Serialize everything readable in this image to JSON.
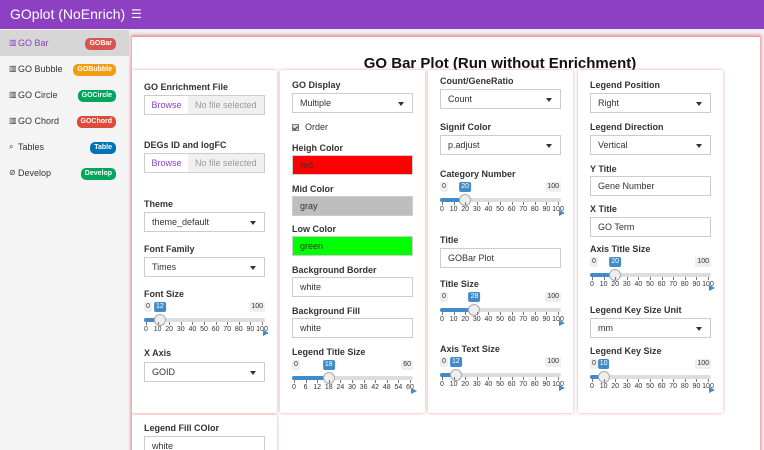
{
  "app": {
    "title": "GOplot (NoEnrich)"
  },
  "header": {
    "toggle_icon": "hamburger-icon"
  },
  "sidebar": {
    "items": [
      {
        "label": "GO Bar",
        "badge": "GOBar",
        "badge_color": "#d9534f",
        "icon": "barcode-icon",
        "active": true
      },
      {
        "label": "GO Bubble",
        "badge": "GOBubble",
        "badge_color": "#f39c12",
        "icon": "chart-icon"
      },
      {
        "label": "GO Circle",
        "badge": "GOCircle",
        "badge_color": "#00a65a",
        "icon": "chart-icon"
      },
      {
        "label": "GO Chord",
        "badge": "GOChord",
        "badge_color": "#dd4b39",
        "icon": "chart-icon"
      },
      {
        "label": "Tables",
        "badge": "Table",
        "badge_color": "#0073b7",
        "icon": "table-icon"
      },
      {
        "label": "Develop",
        "badge": "Develop",
        "badge_color": "#00a65a",
        "icon": "dev-icon"
      }
    ]
  },
  "page": {
    "title": "GO Bar Plot (Run without Enrichment)"
  },
  "col1": {
    "enrich_label": "GO Enrichment File",
    "enrich_browse": "Browse",
    "enrich_file": "No file selected",
    "degs_label": "DEGs ID and logFC",
    "degs_browse": "Browse",
    "degs_file": "No file selected",
    "theme_label": "Theme",
    "theme_value": "theme_default",
    "font_family_label": "Font Family",
    "font_family_value": "Times",
    "font_size_label": "Font Size",
    "font_size": {
      "min": "0",
      "max": "100",
      "value": "12",
      "ticks": [
        "0",
        "10",
        "20",
        "30",
        "40",
        "50",
        "60",
        "70",
        "80",
        "90",
        "100"
      ]
    },
    "xaxis_label": "X Axis",
    "xaxis_value": "GOID",
    "legend_fill_label": "Legend Fill COlor",
    "legend_fill_value": "white"
  },
  "col2": {
    "display_label": "GO Display",
    "display_value": "Multiple",
    "order_label": "Order",
    "heigh_label": "Heigh Color",
    "heigh_value": "red",
    "heigh_color": "#ff0000",
    "mid_label": "Mid Color",
    "mid_value": "gray",
    "mid_color": "#bebebe",
    "low_label": "Low Color",
    "low_value": "green",
    "low_color": "#00ff00",
    "bg_border_label": "Background Border",
    "bg_border_value": "white",
    "bg_fill_label": "Background Fill",
    "bg_fill_value": "white",
    "legend_title_size_label": "Legend Title Size",
    "legend_title_size": {
      "min": "0",
      "max": "60",
      "value": "18",
      "ticks": [
        "0",
        "6",
        "12",
        "18",
        "24",
        "30",
        "36",
        "42",
        "48",
        "54",
        "60"
      ]
    }
  },
  "col3": {
    "count_label": "Count/GeneRatio",
    "count_value": "Count",
    "signif_label": "Signif Color",
    "signif_value": "p.adjust",
    "category_label": "Category Number",
    "category": {
      "min": "0",
      "max": "100",
      "value": "20",
      "ticks": [
        "0",
        "10",
        "20",
        "30",
        "40",
        "50",
        "60",
        "70",
        "80",
        "90",
        "100"
      ]
    },
    "title_label": "Title",
    "title_value": "GOBar Plot",
    "title_size_label": "Title Size",
    "title_size": {
      "min": "0",
      "max": "100",
      "value": "28",
      "ticks": [
        "0",
        "10",
        "20",
        "30",
        "40",
        "50",
        "60",
        "70",
        "80",
        "90",
        "100"
      ]
    },
    "axis_text_size_label": "Axis Text Size",
    "axis_text_size": {
      "min": "0",
      "max": "100",
      "value": "12",
      "ticks": [
        "0",
        "10",
        "20",
        "30",
        "40",
        "50",
        "60",
        "70",
        "80",
        "90",
        "100"
      ]
    }
  },
  "col4": {
    "legend_pos_label": "Legend Position",
    "legend_pos_value": "Right",
    "legend_dir_label": "Legend Direction",
    "legend_dir_value": "Vertical",
    "ytitle_label": "Y Title",
    "ytitle_value": "Gene Number",
    "xtitle_label": "X Title",
    "xtitle_value": "GO Term",
    "axis_title_size_label": "Axis Title Size",
    "axis_title_size": {
      "min": "0",
      "max": "100",
      "value": "20",
      "ticks": [
        "0",
        "10",
        "20",
        "30",
        "40",
        "50",
        "60",
        "70",
        "80",
        "90",
        "100"
      ]
    },
    "legend_key_unit_label": "Legend Key Size Unit",
    "legend_key_unit_value": "mm",
    "legend_key_size_label": "Legend Key Size",
    "legend_key_size": {
      "min": "0",
      "max": "100",
      "value": "10",
      "ticks": [
        "0",
        "10",
        "20",
        "30",
        "40",
        "50",
        "60",
        "70",
        "80",
        "90",
        "100"
      ]
    }
  }
}
